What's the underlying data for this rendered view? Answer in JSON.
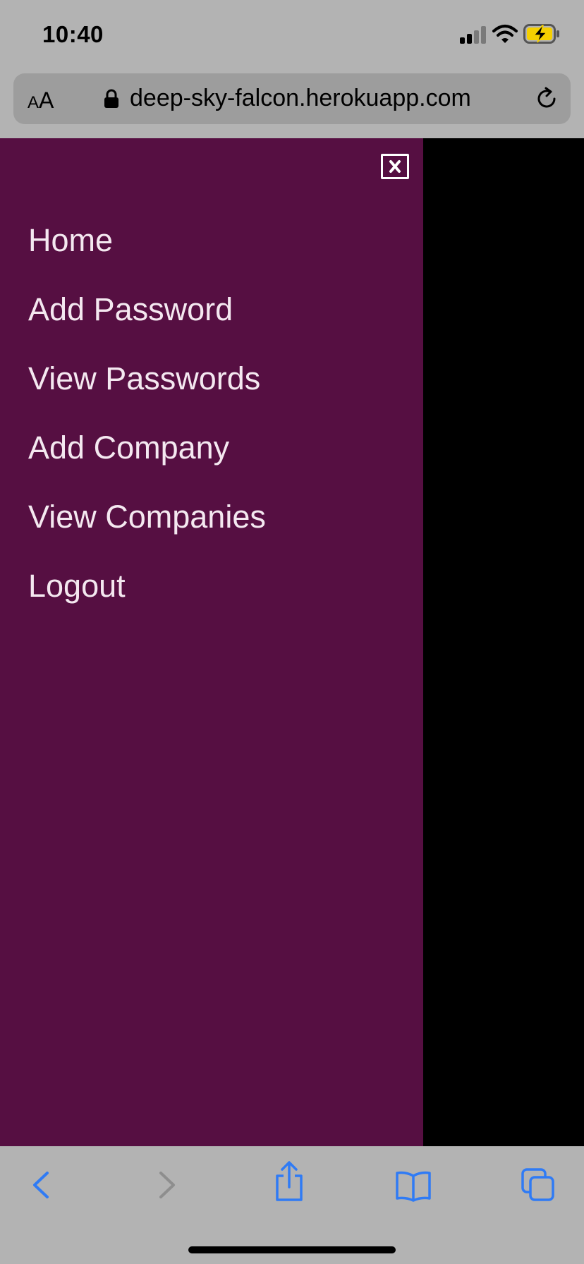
{
  "status_bar": {
    "time": "10:40",
    "icons": [
      "signal-icon",
      "wifi-icon",
      "battery-charging-icon"
    ]
  },
  "browser": {
    "text_size_small": "A",
    "text_size_large": "A",
    "url": "deep-sky-falcon.herokuapp.com",
    "icons": [
      "lock-icon",
      "reload-icon"
    ]
  },
  "drawer": {
    "background_color": "#560f42",
    "text_color": "#f4e8f0",
    "close_icon": "close-icon",
    "nav_items": [
      {
        "label": "Home"
      },
      {
        "label": "Add Password"
      },
      {
        "label": "View Passwords"
      },
      {
        "label": "Add Company"
      },
      {
        "label": "View Companies"
      },
      {
        "label": "Logout"
      }
    ]
  },
  "toolbar": {
    "accent_color": "#2f7bf5",
    "buttons": [
      "back-icon",
      "forward-icon",
      "share-icon",
      "bookmarks-icon",
      "tabs-icon"
    ]
  }
}
